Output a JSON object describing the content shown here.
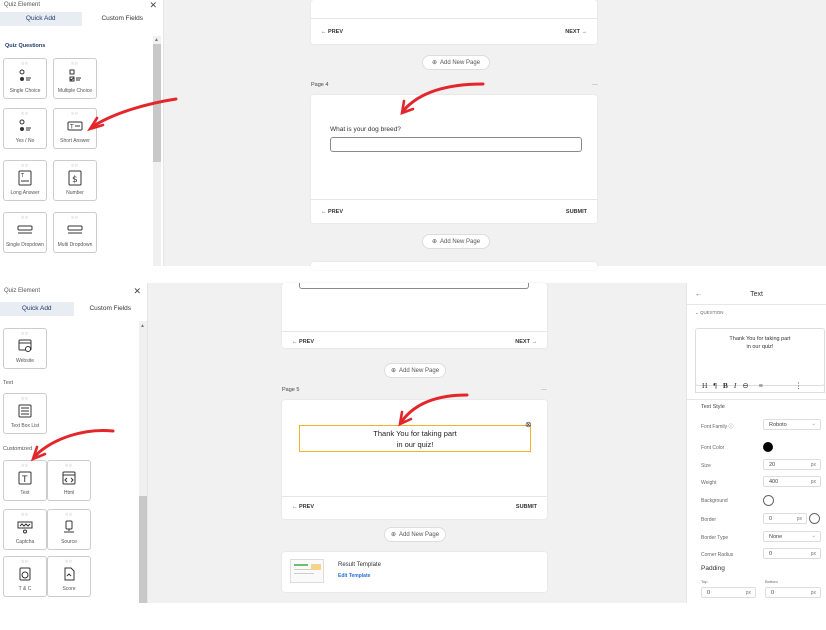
{
  "top": {
    "sidebar": {
      "title": "Quiz Element",
      "close": "✕",
      "tabs": [
        {
          "label": "Quick Add"
        },
        {
          "label": "Custom Fields"
        }
      ],
      "section": "Quiz Questions",
      "tiles": [
        {
          "label": "Single Choice",
          "icon": "single-choice-icon"
        },
        {
          "label": "Multiple Choice",
          "icon": "multiple-choice-icon"
        },
        {
          "label": "Yes / No",
          "icon": "yes-no-icon"
        },
        {
          "label": "Short Answer",
          "icon": "short-answer-icon"
        },
        {
          "label": "Long Answer",
          "icon": "long-answer-icon"
        },
        {
          "label": "Number",
          "icon": "number-icon"
        },
        {
          "label": "Single Dropdown",
          "icon": "single-dropdown-icon"
        },
        {
          "label": "Multi Dropdown",
          "icon": "multi-dropdown-icon"
        }
      ]
    },
    "canvas": {
      "prev": "← PREV",
      "next": "NEXT →",
      "add_page": "Add New Page",
      "page_label": "Page 4",
      "more": "...",
      "question": "What is your dog breed?",
      "prev2": "← PREV",
      "submit": "SUBMIT",
      "add_page2": "Add New Page"
    }
  },
  "bottom": {
    "sidebar": {
      "title": "Quiz Element",
      "close": "✕",
      "tabs": [
        {
          "label": "Quick Add"
        },
        {
          "label": "Custom Fields"
        }
      ],
      "tiles_top": [
        {
          "label": "Website",
          "icon": "website-icon"
        }
      ],
      "section_text": "Text",
      "tiles_text": [
        {
          "label": "Text Box List",
          "icon": "text-box-list-icon"
        }
      ],
      "section_custom": "Customized",
      "tiles_custom": [
        {
          "label": "Text",
          "icon": "text-icon"
        },
        {
          "label": "Html",
          "icon": "html-icon"
        },
        {
          "label": "Captcha",
          "icon": "captcha-icon"
        },
        {
          "label": "Source",
          "icon": "source-icon"
        },
        {
          "label": "T & C",
          "icon": "terms-icon"
        },
        {
          "label": "Score",
          "icon": "score-icon"
        }
      ]
    },
    "canvas": {
      "prev": "← PREV",
      "next": "NEXT →",
      "add_page": "Add New Page",
      "page_label": "Page 5",
      "more": "...",
      "thank_line1": "Thank You for taking part",
      "thank_line2": "in our quiz!",
      "prev2": "← PREV",
      "submit": "SUBMIT",
      "add_page2": "Add New Page",
      "result_title": "Result Template",
      "result_edit": "Edit Template"
    },
    "props": {
      "back": "←",
      "title": "Text",
      "section": "QUESTION",
      "preview_line1": "Thank You for taking part",
      "preview_line2": "in our quiz!",
      "toolbar": [
        "H",
        "¶",
        "B",
        "I",
        "⊖",
        "≡",
        "⋮"
      ],
      "text_style": "Text Style",
      "font_family_label": "Font Family",
      "font_family_value": "Roboto",
      "font_color_label": "Font Color",
      "font_color_value": "#000000",
      "size_label": "Size",
      "size_value": "20",
      "weight_label": "Weight",
      "weight_value": "400",
      "background_label": "Background",
      "border_label": "Border",
      "border_value": "0",
      "border_type_label": "Border Type",
      "border_type_value": "None",
      "corner_radius_label": "Corner Radius",
      "corner_radius_value": "0",
      "padding_label": "Padding",
      "top_label": "Top",
      "top_value": "0",
      "bottom_label": "Bottom",
      "bottom_value": "0",
      "unit": "px"
    }
  },
  "colors": {
    "accent": "#1f3a6b",
    "arrow": "#e3262b",
    "highlight": "#f2b32a",
    "link": "#2a6fdb"
  }
}
